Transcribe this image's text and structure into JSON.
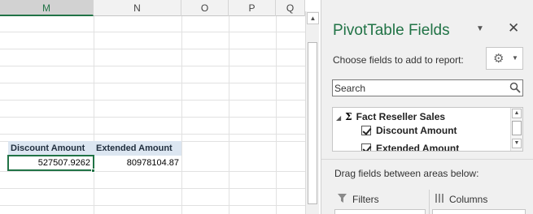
{
  "sheet": {
    "columns": [
      "M",
      "N",
      "O",
      "P",
      "Q"
    ],
    "selected_column": "M",
    "pivot_headers": [
      "Discount Amount",
      "Extended Amount"
    ],
    "pivot_values": [
      "527507.9262",
      "80978104.87"
    ]
  },
  "panel": {
    "title": "PivotTable Fields",
    "choose_label": "Choose fields to add to report:",
    "search_placeholder": "Search",
    "table_name": "Fact Reseller Sales",
    "sigma": "Σ",
    "fields": [
      {
        "label": "Discount Amount",
        "checked": true
      },
      {
        "label": "Extended Amount",
        "checked": true
      }
    ],
    "drag_label": "Drag fields between areas below:",
    "areas": [
      "Filters",
      "Columns"
    ]
  },
  "icons": {
    "panel_dropdown": "chevron-down-icon",
    "panel_close": "close-icon",
    "gear": "gear-icon",
    "search": "search-icon",
    "filter": "filter-icon",
    "columns": "columns-icon"
  },
  "colors": {
    "accent": "#217346",
    "pivot_header_bg": "#dce6f1",
    "panel_bg": "#f0f0f0"
  }
}
